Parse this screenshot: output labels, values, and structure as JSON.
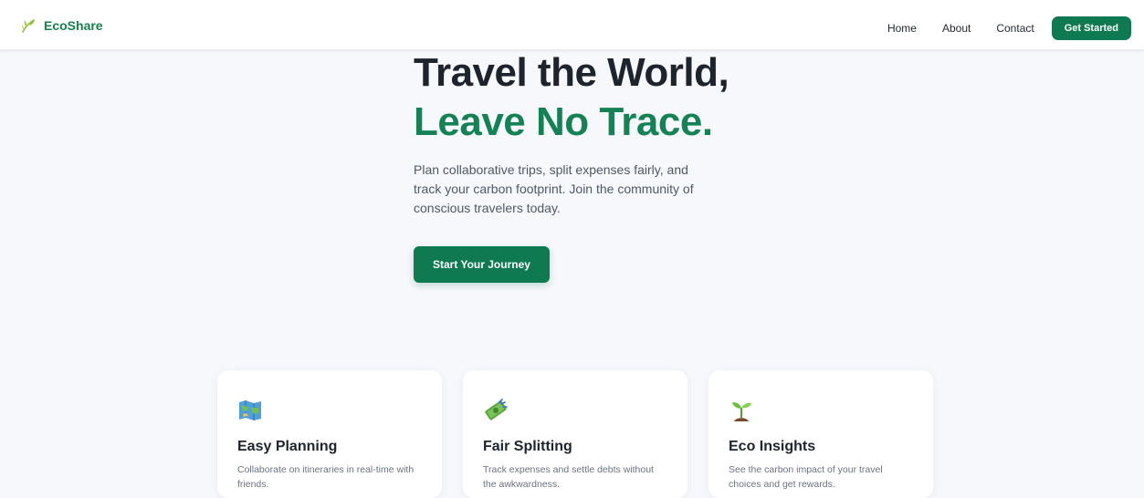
{
  "nav": {
    "brand": "EcoShare",
    "brand_icon": "leaf-icon",
    "links": [
      "Home",
      "About",
      "Contact"
    ],
    "cta_label": "Get Started"
  },
  "hero": {
    "title_line1": "Travel the World,",
    "title_line2": "Leave No Trace.",
    "subtitle": "Plan collaborative trips, split expenses fairly, and track your carbon footprint. Join the community of conscious travelers today.",
    "button_label": "Start Your Journey"
  },
  "features": [
    {
      "icon": "map-icon",
      "title": "Easy Planning",
      "desc": "Collaborate on itineraries in real-time with friends."
    },
    {
      "icon": "money-icon",
      "title": "Fair Splitting",
      "desc": "Track expenses and settle debts without the awkwardness."
    },
    {
      "icon": "seedling-icon",
      "title": "Eco Insights",
      "desc": "See the carbon impact of your travel choices and get rewards."
    }
  ],
  "colors": {
    "accent": "#0f7a52",
    "brand_text": "#17804f",
    "heading": "#1e242d",
    "background": "#f7f8fc"
  }
}
